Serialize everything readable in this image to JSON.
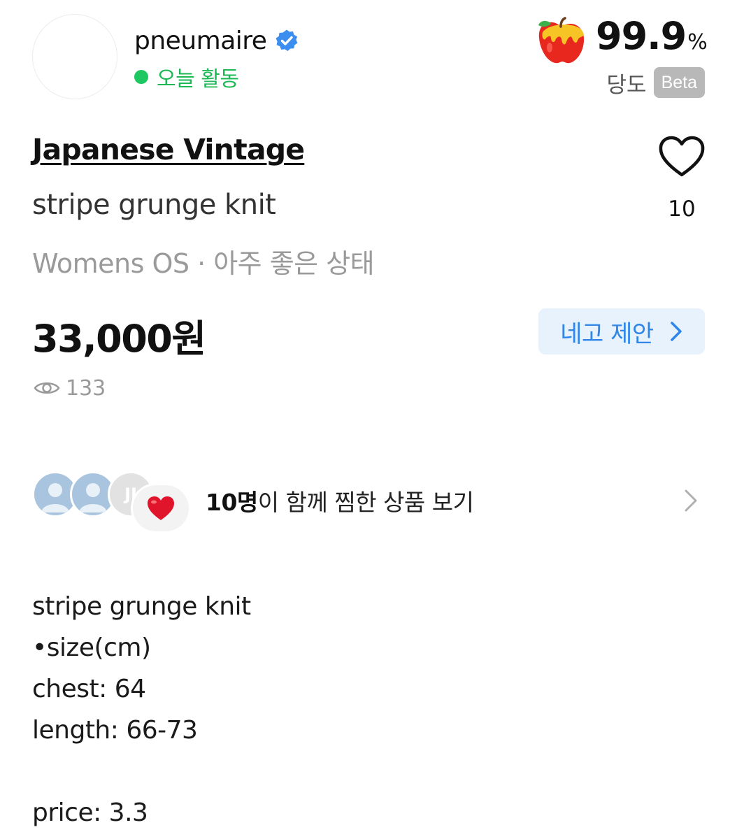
{
  "seller": {
    "name": "pneumaire",
    "activity": "오늘 활동",
    "score_value": "99.9",
    "score_unit": "%",
    "sweet_label": "당도",
    "beta_label": "Beta"
  },
  "product": {
    "brand": "Japanese Vintage",
    "title": "stripe grunge knit",
    "meta": "Womens OS · 아주 좋은 상태",
    "price": "33,000원",
    "likes": "10",
    "views": "133",
    "offer_label": "네고 제안"
  },
  "liked_together": {
    "count_text": "10명",
    "rest_text": "이 함께 찜한 상품 보기",
    "third_avatar_initial": "JI"
  },
  "description": [
    "stripe grunge knit",
    "•size(cm)",
    "chest: 64",
    "length: 66-73",
    "",
    "price: 3.3"
  ],
  "icons": {
    "verified": "verified-badge-icon",
    "apple": "apple-icon",
    "heart": "heart-outline-icon",
    "eye": "eye-icon",
    "chevron": "chevron-right-icon",
    "like_emoji": "red-heart-icon"
  },
  "colors": {
    "active_green": "#1db856",
    "offer_blue": "#2e86e8",
    "offer_bg": "#e8f2fd",
    "muted_gray": "#9a9a9a",
    "verified_blue": "#3b8ef0"
  }
}
